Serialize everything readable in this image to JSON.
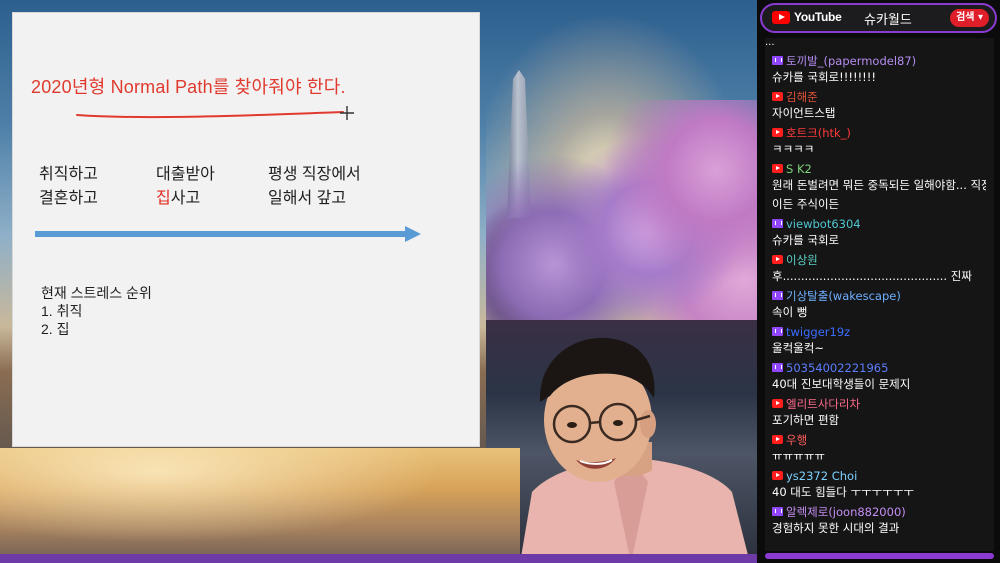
{
  "slide": {
    "title": "2020년형 Normal Path를 찾아줘야 한다.",
    "col1": [
      "취직하고",
      "결혼하고"
    ],
    "col2_line1": "대출받아",
    "col2_line2_red": "집",
    "col2_line2_rest": "사고",
    "col3": [
      "평생 직장에서",
      "일해서 갚고"
    ],
    "stress_title": "현재 스트레스 순위",
    "stress_items": [
      "1.  취직",
      "2.  집"
    ],
    "colors": {
      "title": "#e03a2e",
      "arrow": "#5b9bd5",
      "highlight": "#e32b1f"
    }
  },
  "chat": {
    "logo": "YouTube",
    "channel": "슈카월드",
    "search_label": "검색",
    "cut_line": "...",
    "messages": [
      {
        "platform": "twitch",
        "user": "토끼발_(papermodel87)",
        "color": "#b58df0",
        "text": "슈카를 국회로!!!!!!!!"
      },
      {
        "platform": "youtube",
        "user": "김해준",
        "color": "#e0513b",
        "text": "자이언트스탭"
      },
      {
        "platform": "youtube",
        "user": "호트크(htk_)",
        "color": "#ff3a3a",
        "text": "ㅋㅋㅋㅋ"
      },
      {
        "platform": "youtube",
        "user": "S K2",
        "color": "#7bd47b",
        "text": "원래 돈벌려면 뭐든 중독되든 일해야함... 직장"
      },
      {
        "platform": "none",
        "user": "",
        "color": "#ffffff",
        "text": "이든 주식이든"
      },
      {
        "platform": "twitch",
        "user": "viewbot6304",
        "color": "#4fc6d1",
        "text": "슈카를 국회로"
      },
      {
        "platform": "youtube",
        "user": "이상원",
        "color": "#5bd2c7",
        "text": "후............................................. 진짜"
      },
      {
        "platform": "twitch",
        "user": "기상탈출(wakescape)",
        "color": "#6fb0ff",
        "text": "속이 뻥"
      },
      {
        "platform": "twitch",
        "user": "twigger19z",
        "color": "#3b6dff",
        "text": "울컥울컥~"
      },
      {
        "platform": "twitch",
        "user": "50354002221965",
        "color": "#5c7dff",
        "text": "40대 진보대학생들이 문제지"
      },
      {
        "platform": "youtube",
        "user": "엘리트사다리차",
        "color": "#ff6a8a",
        "text": "포기하면 편함"
      },
      {
        "platform": "youtube",
        "user": "우행",
        "color": "#ff5d5d",
        "text": "ㅠㅠㅠㅠㅠ"
      },
      {
        "platform": "youtube",
        "user": "ys2372 Choi",
        "color": "#7fd1ff",
        "text": "40 대도 힘들다 ㅜㅜㅜㅜㅜㅜ"
      },
      {
        "platform": "twitch",
        "user": "알렉제로(joon882000)",
        "color": "#c58ef5",
        "text": "경험하지 못한 시대의 결과"
      }
    ]
  }
}
